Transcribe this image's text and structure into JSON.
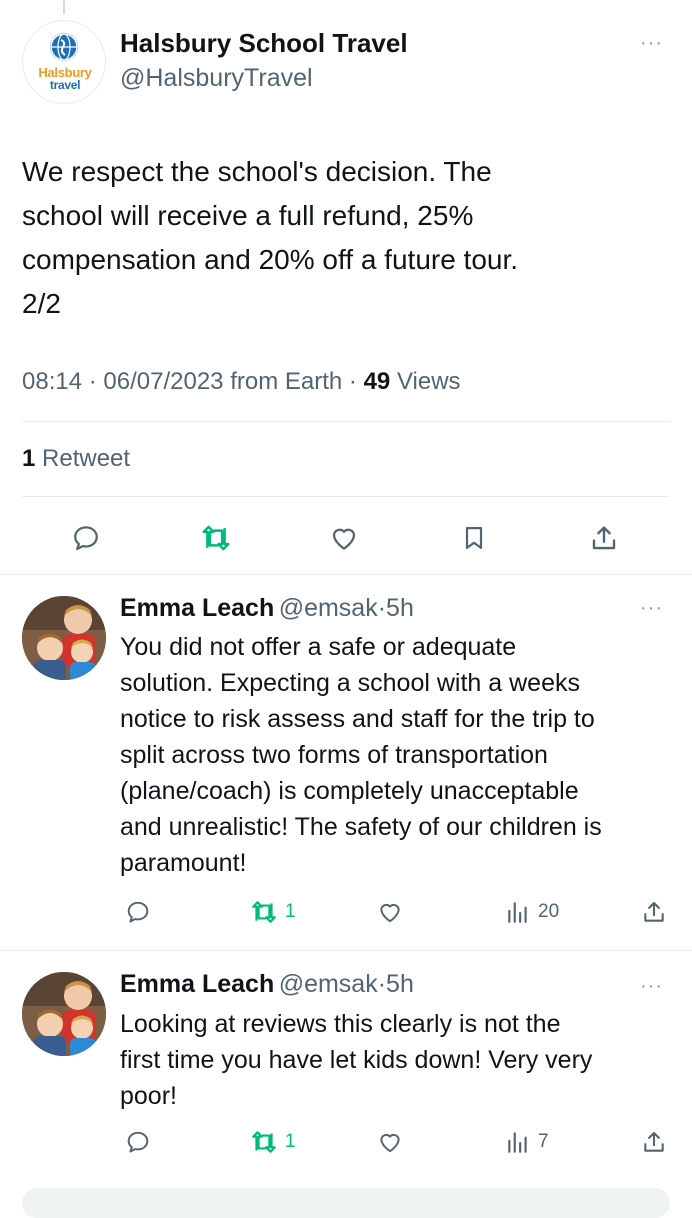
{
  "main_tweet": {
    "display_name": "Halsbury School Travel",
    "handle": "@HalsburyTravel",
    "logo": {
      "word1": "Halsbury",
      "word2": "travel"
    },
    "text_lines": [
      "We respect the school's decision. The",
      "school will receive a full refund, 25%",
      "compensation and 20% off a future tour.",
      "2/2"
    ],
    "time": "08:14",
    "date": "06/07/2023",
    "source": "from Earth",
    "views_count": "49",
    "views_label": "Views",
    "retweet_count": "1",
    "retweet_label": "Retweet",
    "actions": [
      "reply-icon",
      "retweet-icon",
      "like-icon",
      "bookmark-icon",
      "share-icon"
    ]
  },
  "replies": [
    {
      "display_name": "Emma Leach",
      "handle": "@emsak",
      "time": "5h",
      "text_lines": [
        "You did not offer a safe or adequate",
        "solution. Expecting a school with a weeks",
        "notice to risk assess and staff for the trip to",
        "split across two forms of transportation",
        "(plane/coach) is completely unacceptable",
        "and unrealistic! The safety of our children is",
        "paramount!"
      ],
      "retweets": "1",
      "views": "20"
    },
    {
      "display_name": "Emma Leach",
      "handle": "@emsak",
      "time": "5h",
      "text_lines": [
        "Looking at reviews this clearly is not the",
        "first time you have let kids down! Very very",
        "poor!"
      ],
      "retweets": "1",
      "views": "7"
    }
  ],
  "colors": {
    "text": "#0f1419",
    "secondary": "#536471",
    "retweet_green": "#00ba7c",
    "divider": "#e6ecf0",
    "logo_blue": "#1d6fb8",
    "logo_orange": "#f29a1f"
  },
  "separator": "·",
  "more_glyph": "···"
}
